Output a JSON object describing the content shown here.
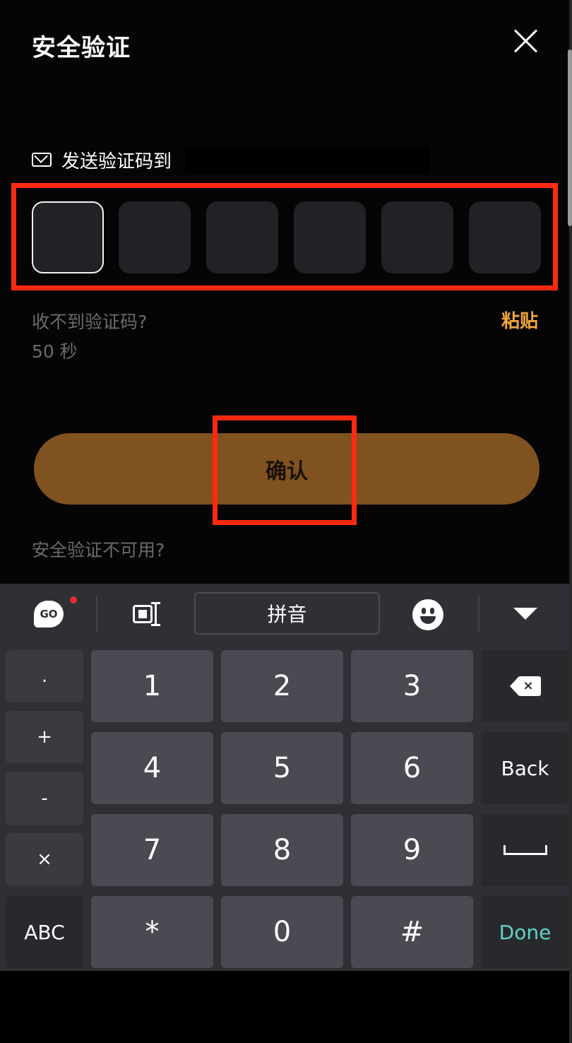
{
  "header": {
    "title": "安全验证",
    "close_icon": "close-icon"
  },
  "send": {
    "icon": "mail-icon",
    "label": "发送验证码到"
  },
  "otp": {
    "box_count": 6,
    "active_index": 0
  },
  "help": {
    "no_code": "收不到验证码?",
    "countdown": "50 秒",
    "paste": "粘贴"
  },
  "confirm": {
    "label": "确认"
  },
  "unavailable": "安全验证不可用?",
  "keyboard": {
    "toolbar": {
      "go": "GO",
      "pinyin": "拼音",
      "emoji_icon": "emoji-icon",
      "collapse_icon": "chevron-down-icon"
    },
    "side_keys": [
      ".",
      "+",
      "-",
      "×",
      "ABC"
    ],
    "num_keys": [
      "1",
      "2",
      "3",
      "4",
      "5",
      "6",
      "7",
      "8",
      "9",
      "*",
      "0",
      "#"
    ],
    "fn_keys": {
      "back": "Back",
      "done": "Done"
    }
  },
  "colors": {
    "accent": "#f0a640",
    "confirm_bg": "#7f5220",
    "annotation": "#ff2a10",
    "done": "#5fd3c4"
  }
}
